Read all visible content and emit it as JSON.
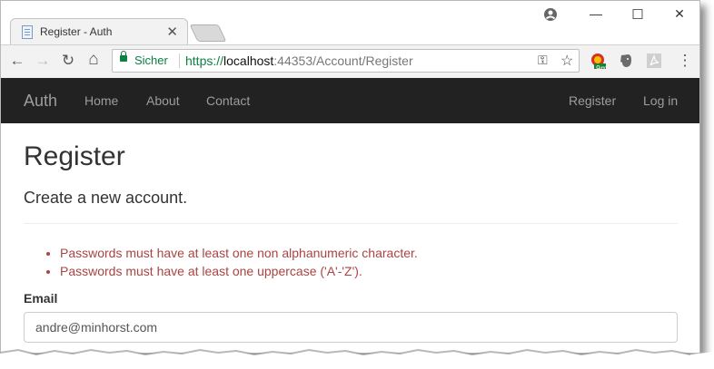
{
  "browser": {
    "tab_title": "Register - Auth",
    "tab_close": "✕",
    "secure_label": "Sicher",
    "url_scheme": "https://",
    "url_host": "localhost",
    "url_rest": ":44353/Account/Register",
    "extension_badge": "9m",
    "controls": {
      "minimize": "—",
      "maximize": "☐",
      "close": "✕"
    },
    "buttons": {
      "back": "←",
      "forward": "→",
      "reload": "↻",
      "home": "⌂",
      "key": "⚿",
      "star": "☆",
      "menu": "⋮"
    }
  },
  "navbar": {
    "brand": "Auth",
    "left_links": [
      "Home",
      "About",
      "Contact"
    ],
    "right_links": [
      "Register",
      "Log in"
    ],
    "background": "#222222",
    "link_color": "#9d9d9d"
  },
  "page": {
    "title": "Register",
    "subtitle": "Create a new account.",
    "errors": [
      "Passwords must have at least one non alphanumeric character.",
      "Passwords must have at least one uppercase ('A'-'Z')."
    ],
    "email_label": "Email",
    "email_value": "andre@minhorst.com",
    "error_color": "#a94442"
  }
}
